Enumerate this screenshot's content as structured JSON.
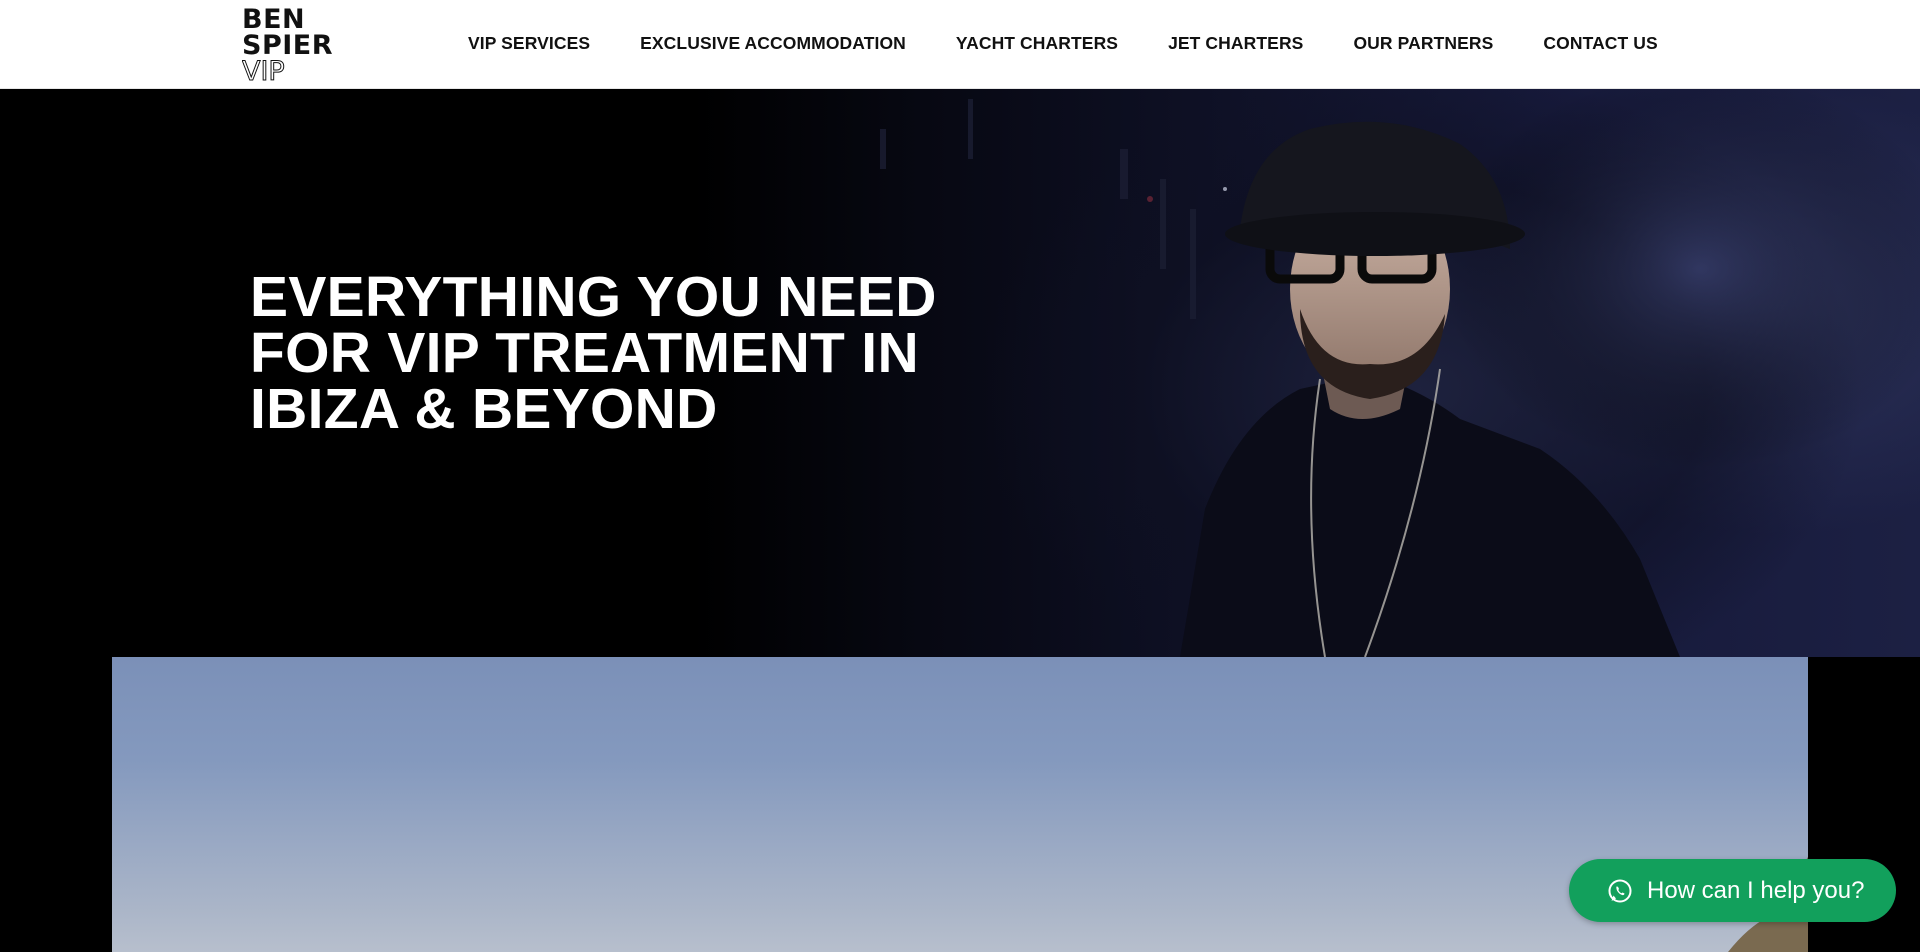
{
  "header": {
    "logo": {
      "line1": "BEN",
      "line2": "SPIER",
      "line3": "VIP"
    },
    "nav": [
      {
        "label": "VIP SERVICES"
      },
      {
        "label": "EXCLUSIVE ACCOMMODATION"
      },
      {
        "label": "YACHT CHARTERS"
      },
      {
        "label": "JET CHARTERS"
      },
      {
        "label": "OUR PARTNERS"
      },
      {
        "label": "CONTACT US"
      }
    ]
  },
  "hero": {
    "title": "EVERYTHING YOU NEED FOR VIP TREATMENT IN IBIZA & BEYOND"
  },
  "chat_widget": {
    "label": "How can I help you?",
    "icon": "whatsapp-icon",
    "color": "#12a05c"
  }
}
